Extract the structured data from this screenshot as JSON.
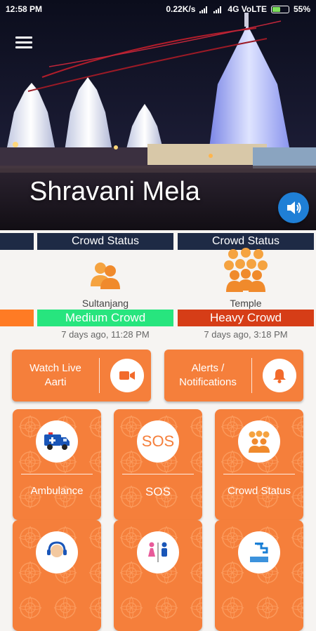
{
  "status_bar": {
    "time": "12:58 PM",
    "network_speed": "0.22K/s",
    "network": "4G VoLTE",
    "battery": "55%",
    "battery_level": 0.55
  },
  "hero": {
    "title": "Shravani Mela",
    "menu_icon": "hamburger-menu-icon",
    "sound_icon": "speaker-icon"
  },
  "crowd_status": {
    "cards": [
      {
        "header": "",
        "location": "",
        "level": "",
        "time": "",
        "level_color": "#ff7b24"
      },
      {
        "header": "Crowd Status",
        "location": "Sultanjang",
        "level": "Medium Crowd",
        "time": "7 days ago, 11:28 PM",
        "level_color": "#27e57e"
      },
      {
        "header": "Crowd Status",
        "location": "Temple",
        "level": "Heavy Crowd",
        "time": "7 days ago, 3:18 PM",
        "level_color": "#d63d17"
      }
    ]
  },
  "actions": {
    "live_aarti": {
      "label": "Watch Live\nAarti",
      "icon": "video-camera-icon"
    },
    "alerts": {
      "label": "Alerts /\nNotifications",
      "icon": "bell-icon"
    }
  },
  "tiles": [
    {
      "label": "Ambulance",
      "icon": "ambulance-icon"
    },
    {
      "label": "SOS",
      "icon": "sos-icon",
      "icon_text": "SOS"
    },
    {
      "label": "Crowd Status",
      "icon": "crowd-icon"
    },
    {
      "label": "",
      "icon": "helpline-icon"
    },
    {
      "label": "",
      "icon": "restroom-icon"
    },
    {
      "label": "",
      "icon": "water-tap-icon"
    }
  ],
  "colors": {
    "accent_orange": "#f57f3b",
    "header_navy": "#1e2a45",
    "medium_crowd": "#27e57e",
    "heavy_crowd": "#d63d17",
    "sound_button": "#1f7fd6"
  }
}
